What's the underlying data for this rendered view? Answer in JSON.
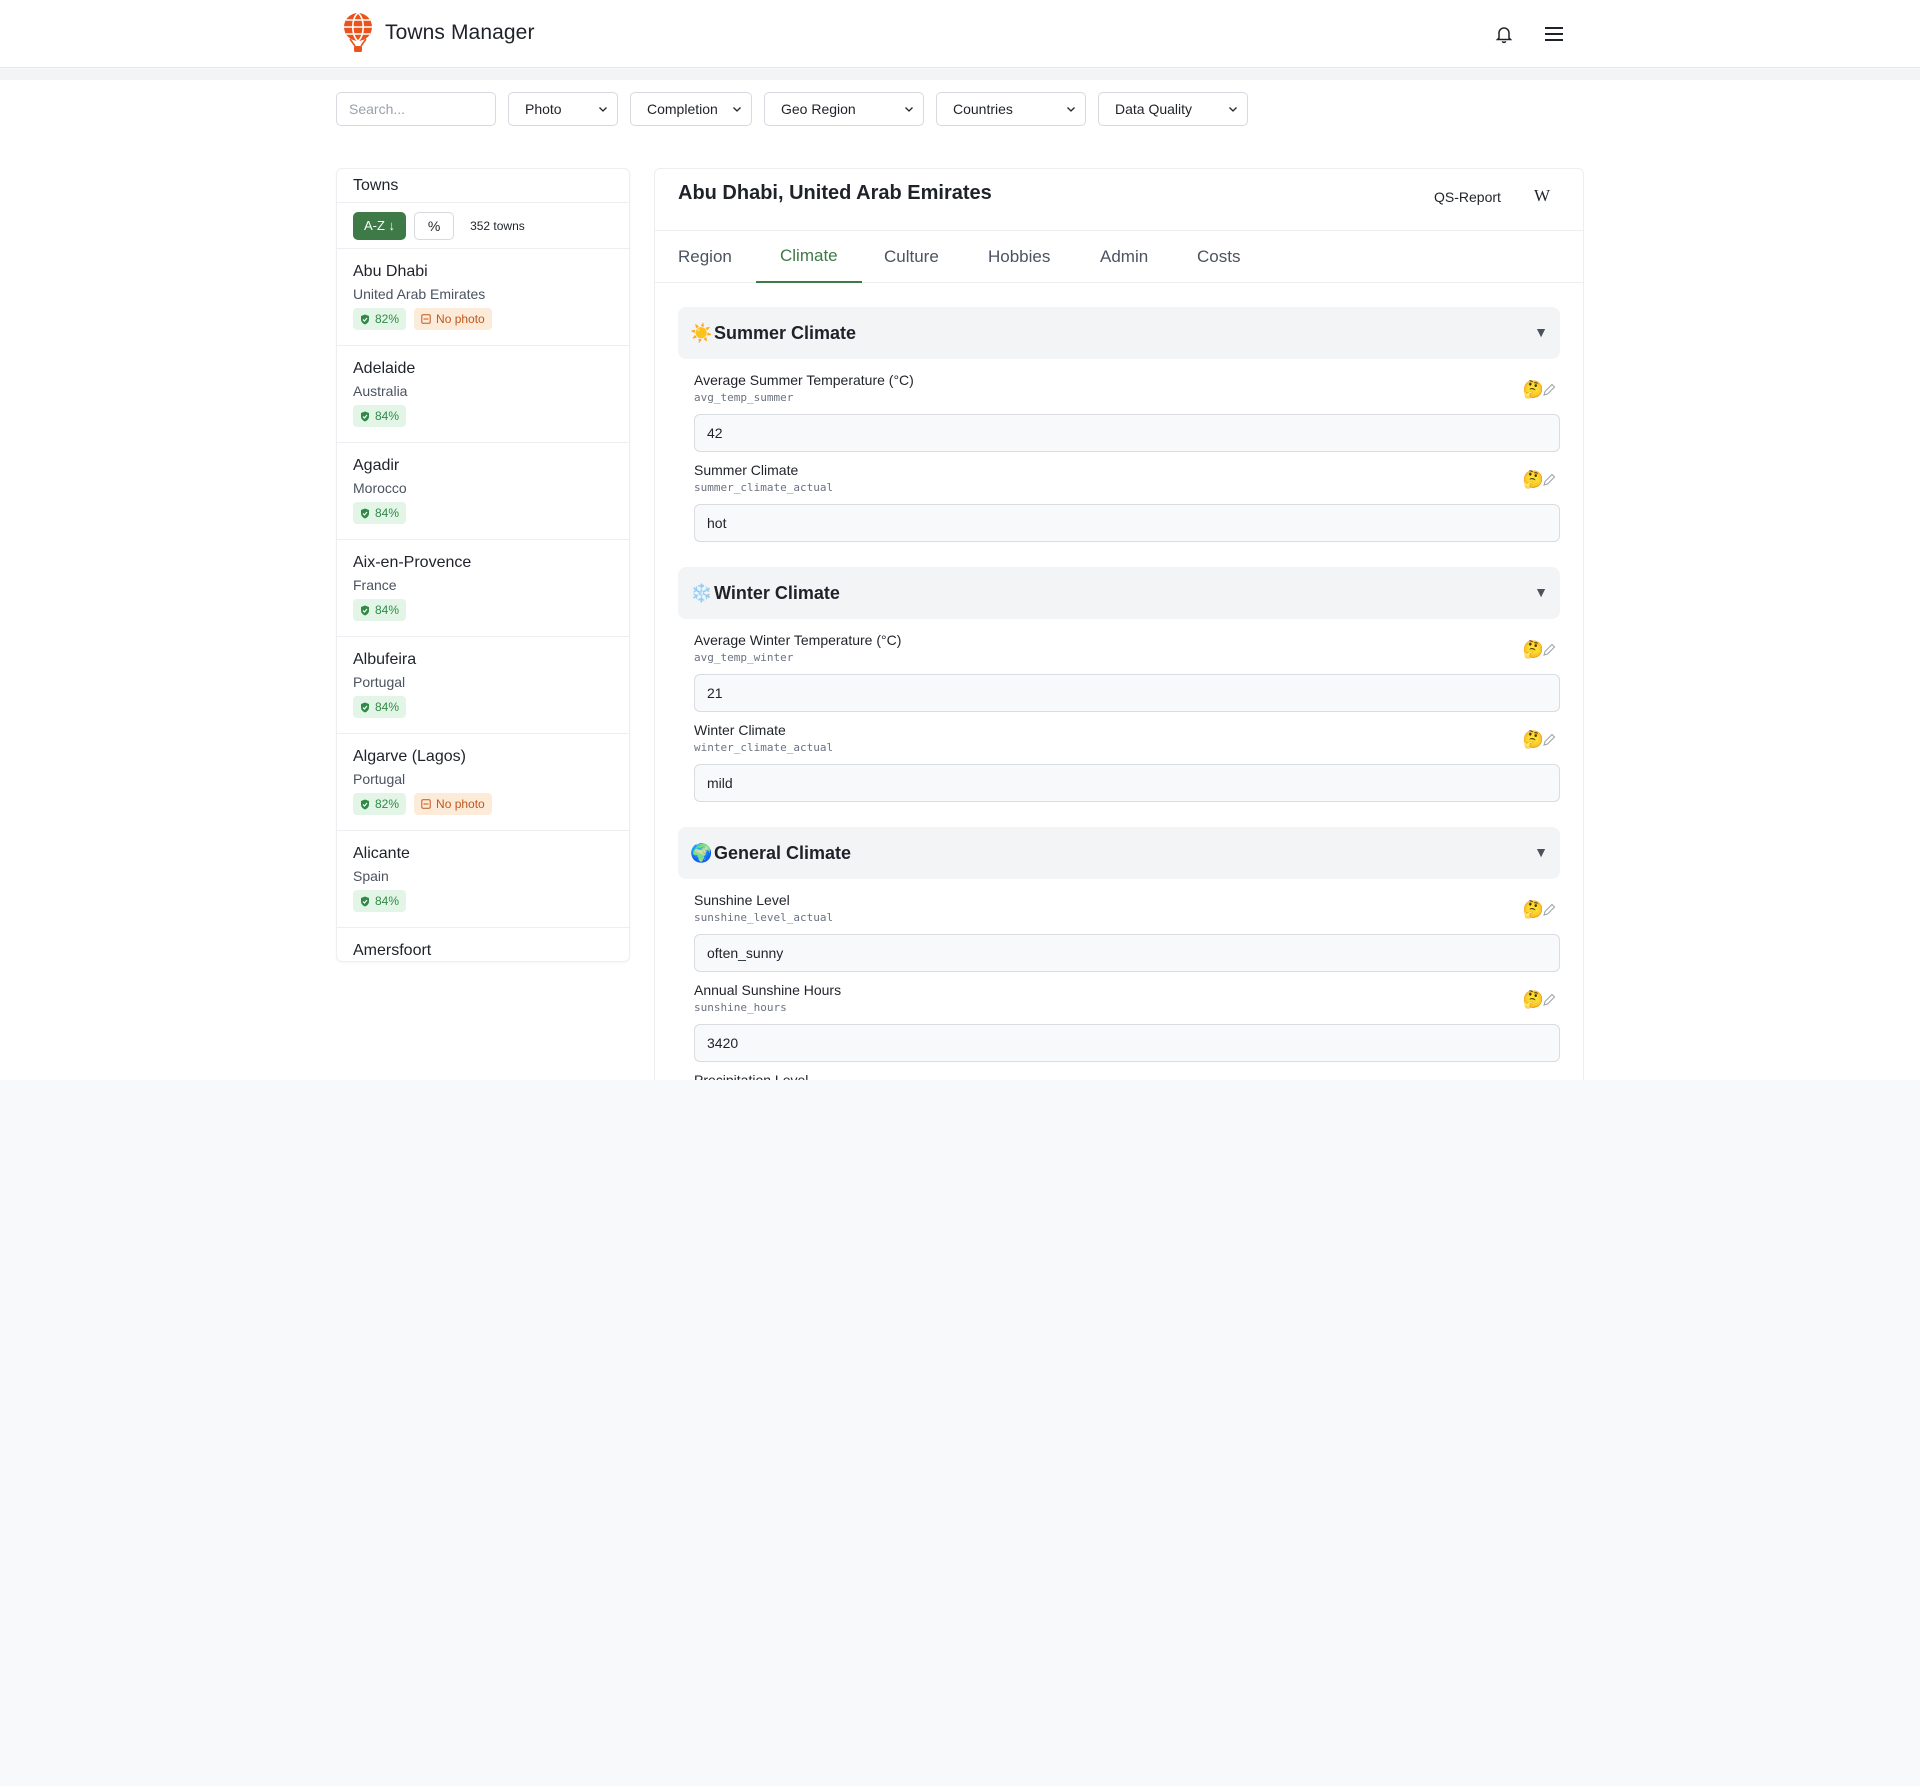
{
  "app": {
    "title": "Towns Manager"
  },
  "icons": {
    "logo": "balloon-logo",
    "bell": "bell-icon",
    "menu": "hamburger-icon"
  },
  "filters": {
    "search_placeholder": "Search...",
    "photo": "Photo",
    "completion": "Completion",
    "geo_region": "Geo Region",
    "countries": "Countries",
    "data_quality": "Data Quality"
  },
  "towns_panel": {
    "title": "Towns",
    "sort_az": "A-Z ↓",
    "sort_pct": "%",
    "count": "352 towns",
    "items": [
      {
        "name": "Abu Dhabi",
        "country": "United Arab Emirates",
        "pct": "82%",
        "no_photo": "No photo"
      },
      {
        "name": "Adelaide",
        "country": "Australia",
        "pct": "84%"
      },
      {
        "name": "Agadir",
        "country": "Morocco",
        "pct": "84%"
      },
      {
        "name": "Aix-en-Provence",
        "country": "France",
        "pct": "84%"
      },
      {
        "name": "Albufeira",
        "country": "Portugal",
        "pct": "84%"
      },
      {
        "name": "Algarve (Lagos)",
        "country": "Portugal",
        "pct": "82%",
        "no_photo": "No photo"
      },
      {
        "name": "Alicante",
        "country": "Spain",
        "pct": "84%"
      },
      {
        "name": "Amersfoort",
        "country": "",
        "pct": ""
      }
    ]
  },
  "detail": {
    "title": "Abu Dhabi, United Arab Emirates",
    "qs_report": "QS-Report",
    "wiki": "W",
    "tabs": [
      "Region",
      "Climate",
      "Culture",
      "Hobbies",
      "Admin",
      "Costs"
    ],
    "active_tab": "Climate",
    "sections": {
      "summer": {
        "emoji": "☀️",
        "title": "Summer Climate"
      },
      "winter": {
        "emoji": "❄️",
        "title": "Winter Climate"
      },
      "general": {
        "emoji": "🌍",
        "title": "General Climate"
      }
    },
    "caret": "▼",
    "think_emoji": "🤔",
    "fields": {
      "avg_temp_summer": {
        "label": "Average Summer Temperature (°C)",
        "key": "avg_temp_summer",
        "value": "42"
      },
      "summer_climate": {
        "label": "Summer Climate",
        "key": "summer_climate_actual",
        "value": "hot"
      },
      "avg_temp_winter": {
        "label": "Average Winter Temperature (°C)",
        "key": "avg_temp_winter",
        "value": "21"
      },
      "winter_climate": {
        "label": "Winter Climate",
        "key": "winter_climate_actual",
        "value": "mild"
      },
      "sunshine_level": {
        "label": "Sunshine Level",
        "key": "sunshine_level_actual",
        "value": "often_sunny"
      },
      "sunshine_hours": {
        "label": "Annual Sunshine Hours",
        "key": "sunshine_hours",
        "value": "3420"
      },
      "precipitation": {
        "label": "Precipitation Level"
      }
    }
  },
  "colors": {
    "accent": "#3d7a47",
    "badge_green": "#2f8a46",
    "badge_orange": "#c2561d",
    "logo": "#e8541c"
  }
}
